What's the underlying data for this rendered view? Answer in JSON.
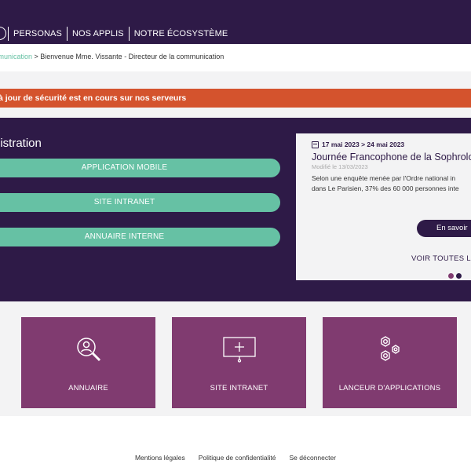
{
  "header": {
    "nav": [
      "PERSONAS",
      "NOS APPLIS",
      "NOTRE ÉCOSYSTÈME"
    ]
  },
  "breadcrumb": {
    "link": "mmunication",
    "separator": " > ",
    "current": "Bienvenue Mme. Vissante - Directeur de la communication"
  },
  "alert": {
    "text": "à jour de sécurité est en cours sur nos serveurs"
  },
  "hero": {
    "title": "nistration",
    "buttons": [
      "APPLICATION MOBILE",
      "SITE INTRANET",
      "ANNUAIRE INTERNE"
    ]
  },
  "news": {
    "date": "17 mai 2023 > 24 mai 2023",
    "title": "Journée Francophone de la Sophrolo",
    "modified": "Modifié le 13/03/2023",
    "excerpt_line1": "Selon une enquête menée par l'Ordre national in",
    "excerpt_line2": "dans Le Parisien, 37% des 60 000 personnes inte",
    "more_label": "En savoir",
    "all_label": "VOIR TOUTES LE",
    "colors": {
      "dot_active": "#803b70",
      "dot_inactive": "#2e1a47"
    }
  },
  "tiles": [
    {
      "label": "ANNUAIRE",
      "icon": "search-user-icon"
    },
    {
      "label": "SITE INTRANET",
      "icon": "monitor-plus-icon"
    },
    {
      "label": "LANCEUR D'APPLICATIONS",
      "icon": "gears-icon"
    }
  ],
  "footer": {
    "links": [
      "Mentions légales",
      "Politique de confidentialité",
      "Se déconnecter"
    ]
  },
  "colors": {
    "primary": "#2e1a47",
    "accent": "#66c1a4",
    "alert": "#d4532d",
    "tile": "#803b70"
  }
}
